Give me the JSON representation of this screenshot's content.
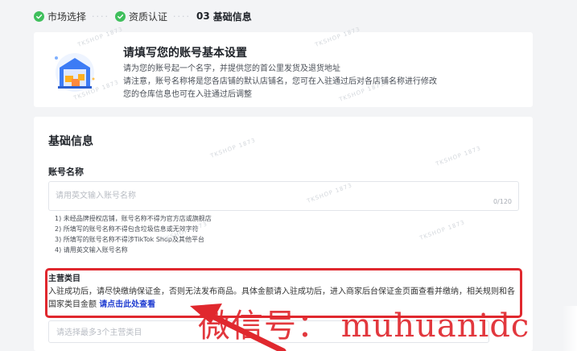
{
  "stepper": {
    "step1": "市场选择",
    "step2": "资质认证",
    "step3_num": "03",
    "step3": "基础信息",
    "separator": "····"
  },
  "intro": {
    "title": "请填写您的账号基本设置",
    "line1": "请为您的账号起一个名字，并提供您的首公里发货及退货地址",
    "line2": "请注意，账号名称将是您各店铺的默认店铺名，您可在入驻通过后对各店铺名称进行修改",
    "line3": "您的仓库信息也可在入驻通过后调整"
  },
  "form": {
    "section_title": "基础信息",
    "account_name_label": "账号名称",
    "account_name_placeholder": "请用英文输入账号名称",
    "account_name_value": "",
    "char_count": "0/120",
    "rules": [
      "1) 未经品牌授权店铺，账号名称不得为官方店或旗舰店",
      "2) 所填写的账号名称不得包含垃圾信息或无效字符",
      "3) 所填写的账号名称不得涉TikTok Shop及其他平台",
      "4) 请用英文输入账号名称"
    ],
    "category_label": "主营类目",
    "category_notice": "入驻成功后，请尽快缴纳保证金，否则无法发布商品。具体金额请入驻成功后，进入商家后台保证金页面查看并缴纳，相关规则和各国家类目金额",
    "category_link": "请点击此处查看",
    "category_placeholder": "请选择最多3个主营类目"
  },
  "overlay": {
    "text": "微信号： muhuanidc"
  },
  "watermark": "TKSHOP 1873",
  "colors": {
    "check_green": "#3fbf5c",
    "highlight_red": "#e0282e",
    "link_blue": "#1f3cd1"
  }
}
